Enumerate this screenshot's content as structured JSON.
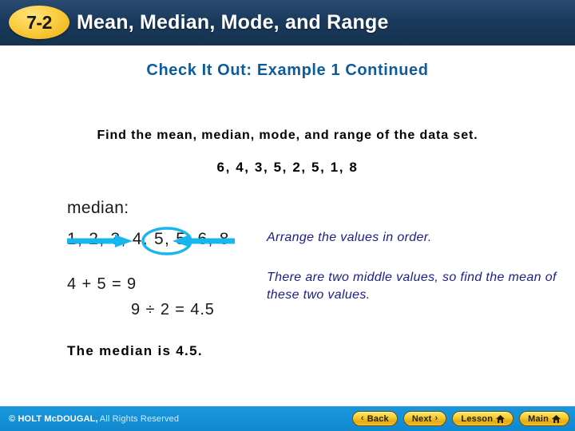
{
  "header": {
    "badge": "7-2",
    "title": "Mean, Median, Mode, and Range",
    "bg_color": "#1a3a5d",
    "badge_color": "#f2bd25"
  },
  "subtitle": {
    "text": "Check It Out: Example 1 Continued",
    "color": "#0c5c9b"
  },
  "problem": {
    "instruction": "Find the mean, median, mode, and range of the data set.",
    "dataset": "6, 4, 3, 5, 2, 5, 1, 8"
  },
  "work": {
    "median_label": "median:",
    "sorted_values": "1, 2, 3, 4, 5, 5, 6, 8",
    "circled_values": "4, 5",
    "calc_sum": "4 + 5 = 9",
    "calc_divide": "9 ÷ 2 = 4.5",
    "conclusion": "The median is 4.5.",
    "annotation_color": "#18b6ef"
  },
  "notes": {
    "note_1": "Arrange the values in order.",
    "note_2": "There are two middle values, so find the mean of these two values.",
    "color": "#1b1d8c"
  },
  "footer": {
    "copyright_strong": "© HOLT McDOUGAL,",
    "copyright_rest": "All Rights Reserved",
    "bg_color": "#1490d7",
    "buttons": [
      {
        "label": "Back",
        "icon": "chevron-left-icon",
        "glyph": "‹"
      },
      {
        "label": "Next",
        "icon": "chevron-right-icon",
        "glyph": "›"
      },
      {
        "label": "Lesson",
        "icon": "home-icon",
        "glyph": ""
      },
      {
        "label": "Main",
        "icon": "home-icon",
        "glyph": ""
      }
    ]
  }
}
